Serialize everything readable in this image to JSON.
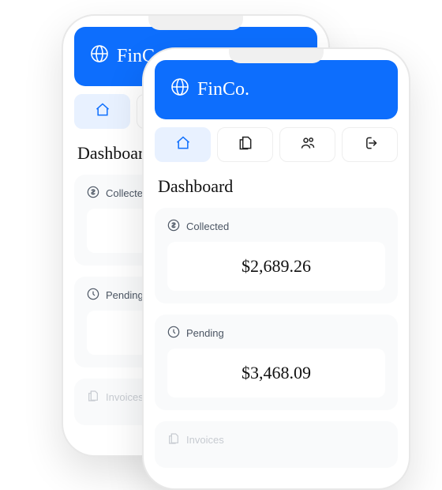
{
  "app": {
    "name": "FinCo."
  },
  "nav": {
    "home": "Home",
    "documents": "Documents",
    "customers": "Customers",
    "logout": "Logout"
  },
  "page": {
    "title": "Dashboard"
  },
  "cards": {
    "collected": {
      "label": "Collected",
      "value": "$2,689.26"
    },
    "pending": {
      "label": "Pending",
      "value": "$3,468.09"
    },
    "invoices": {
      "label": "Invoices"
    }
  }
}
